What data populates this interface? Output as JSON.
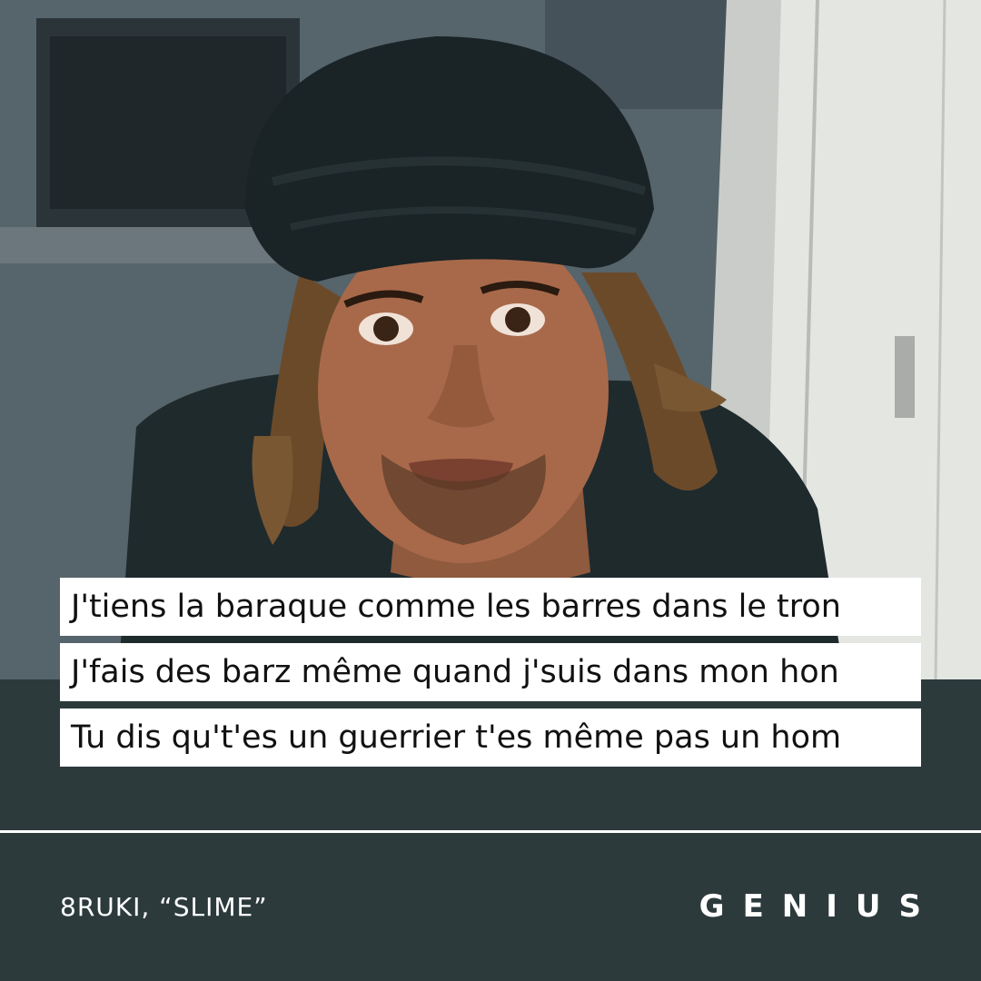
{
  "photo": {
    "subject": "portrait-photo",
    "colors": {
      "wall": "#55636a",
      "door": "#d9dcd8",
      "turban": "#1a2326",
      "skin": "#a8694a",
      "hair": "#6b4a2a",
      "shirt": "#1f2a2d"
    }
  },
  "lyrics": [
    "J'tiens la baraque comme les barres dans le tron",
    "J'fais des barz même quand j'suis dans mon hon",
    "Tu dis qu't'es un guerrier t'es même pas un hom"
  ],
  "footer": {
    "credit": "8RUKI, “SLIME”",
    "logo": "GENIUS"
  },
  "colors": {
    "background": "#2c3a3c",
    "lyric_bg": "#ffffff",
    "lyric_text": "#111111",
    "footer_text": "#ffffff"
  }
}
